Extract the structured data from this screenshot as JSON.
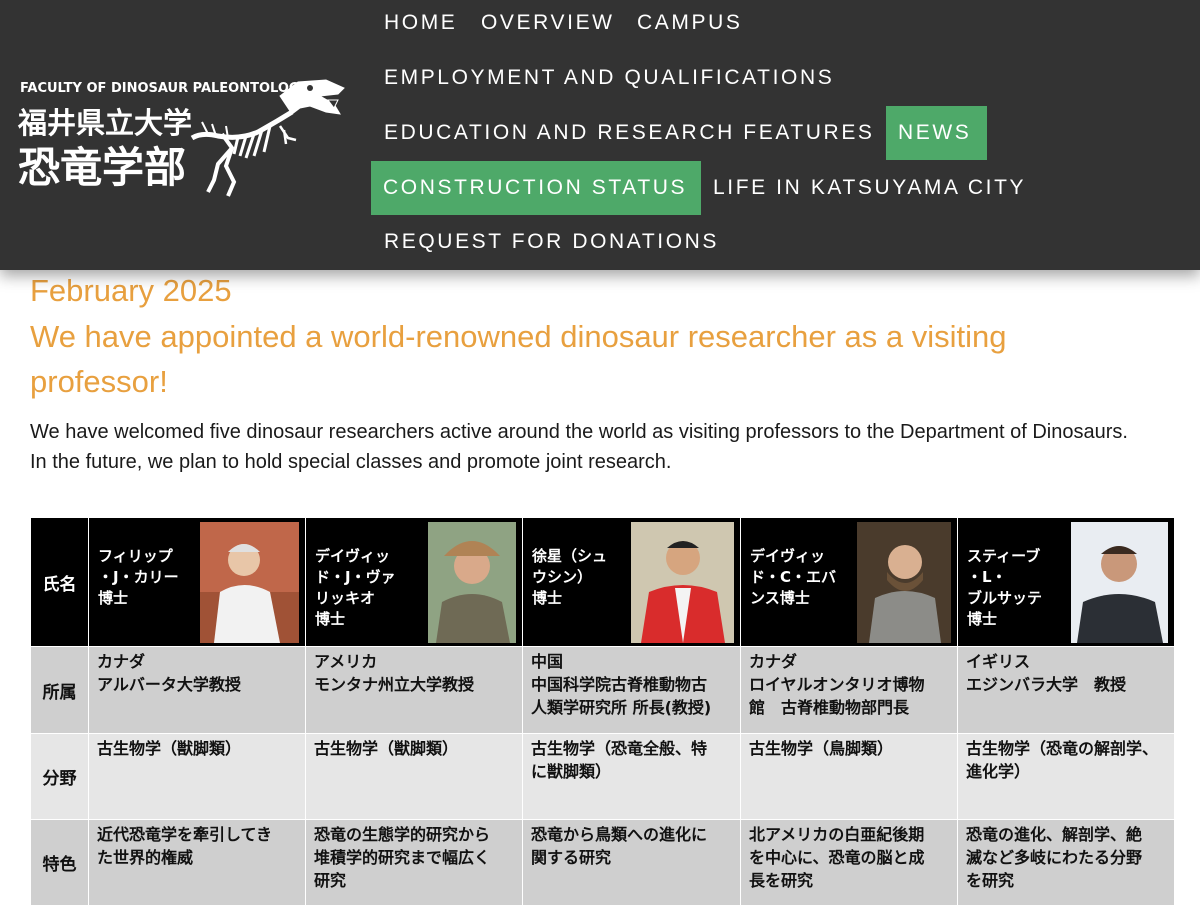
{
  "logo": {
    "en": "FACULTY OF DINOSAUR PALEONTOLOGY",
    "jp_line1": "福井県立大学",
    "jp_line2": "恐竜学部"
  },
  "nav": {
    "home": "HOME",
    "overview": "OVERVIEW",
    "campus": "CAMPUS",
    "employment": "EMPLOYMENT AND QUALIFICATIONS",
    "education": "EDUCATION AND RESEARCH FEATURES",
    "news": "NEWS",
    "construction": "CONSTRUCTION STATUS",
    "life": "LIFE IN KATSUYAMA CITY",
    "donations": "REQUEST FOR DONATIONS"
  },
  "colors": {
    "header_bg": "#333333",
    "active_nav": "#4ea969",
    "accent": "#e8a03f"
  },
  "article": {
    "date": "February 2025",
    "headline": "We have appointed a world-renowned dinosaur researcher as a visiting professor!",
    "body_line1": "We have welcomed five dinosaur researchers active around the world as visiting professors to the Department of Dinosaurs.",
    "body_line2": "In the future, we plan to hold special classes and promote joint research."
  },
  "table": {
    "row_labels": {
      "name": "氏名",
      "affiliation": "所属",
      "field": "分野",
      "feature": "特色"
    },
    "professors": [
      {
        "name": [
          "フィリップ",
          "・J・カリー",
          "博士"
        ],
        "affiliation": [
          "カナダ",
          "アルバータ大学教授"
        ],
        "field": [
          "古生物学（獣脚類）"
        ],
        "feature": [
          "近代恐竜学を牽引してき",
          "た世界的権威"
        ]
      },
      {
        "name": [
          "デイヴィッ",
          "ド・J・ヴァ",
          "リッキオ",
          "博士"
        ],
        "affiliation": [
          "アメリカ",
          "モンタナ州立大学教授"
        ],
        "field": [
          "古生物学（獣脚類）"
        ],
        "feature": [
          "恐竜の生態学的研究から",
          "堆積学的研究まで幅広く",
          "研究"
        ]
      },
      {
        "name": [
          "徐星（シュ",
          "ウシン）",
          "博士"
        ],
        "affiliation": [
          "中国",
          "中国科学院古脊椎動物古",
          "人類学研究所 所長(教授)"
        ],
        "field": [
          "古生物学（恐竜全般、特",
          "に獣脚類）"
        ],
        "feature": [
          "恐竜から鳥類への進化に",
          "関する研究"
        ]
      },
      {
        "name": [
          "デイヴィッ",
          "ド・C・エバ",
          "ンス博士"
        ],
        "affiliation": [
          "カナダ",
          "ロイヤルオンタリオ博物",
          "館　古脊椎動物部門長"
        ],
        "field": [
          "古生物学（鳥脚類）"
        ],
        "feature": [
          "北アメリカの白亜紀後期",
          "を中心に、恐竜の脳と成",
          "長を研究"
        ]
      },
      {
        "name": [
          "スティーブ",
          "・L・",
          "ブルサッテ",
          "博士"
        ],
        "affiliation": [
          "イギリス",
          "エジンバラ大学　教授"
        ],
        "field": [
          "古生物学（恐竜の解剖学、",
          "進化学）"
        ],
        "feature": [
          "恐竜の進化、解剖学、絶",
          "滅など多岐にわたる分野",
          "を研究"
        ]
      }
    ]
  }
}
